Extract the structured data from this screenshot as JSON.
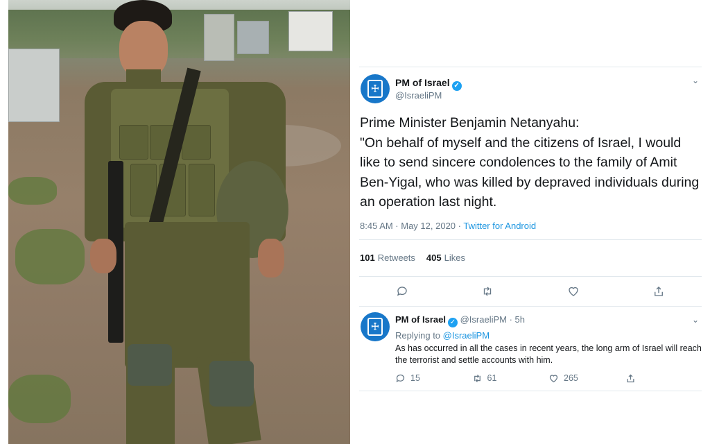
{
  "photo": {
    "alt_subject": "soldier-photo"
  },
  "tweet": {
    "author_name": "PM of Israel",
    "author_handle": "@IsraeliPM",
    "body_line1": "Prime Minister Benjamin Netanyahu:",
    "body_line2": "\"On behalf of myself and the citizens of Israel, I would like to send sincere condolences to the family of Amit Ben-Yigal, who was killed by depraved individuals during an operation last night.",
    "timestamp": "8:45 AM · May 12, 2020 · ",
    "app": "Twitter for Android",
    "retweets_count": "101",
    "retweets_label": "Retweets",
    "likes_count": "405",
    "likes_label": "Likes",
    "actions": [
      {
        "icon": "reply-icon"
      },
      {
        "icon": "retweet-icon"
      },
      {
        "icon": "like-icon"
      },
      {
        "icon": "share-icon"
      }
    ]
  },
  "reply": {
    "author_name": "PM of Israel",
    "author_handle": "@IsraeliPM · 5h",
    "replying_prefix": "Replying to ",
    "replying_to": "@IsraeliPM",
    "text": "As has occurred in all the cases in recent years, the long arm of Israel will reach the terrorist and settle accounts with him.",
    "reply_count": "15",
    "retweet_count": "61",
    "like_count": "265"
  },
  "colors": {
    "accent": "#1da1f2",
    "link": "#1b95e0",
    "avatar": "#1877c9"
  }
}
